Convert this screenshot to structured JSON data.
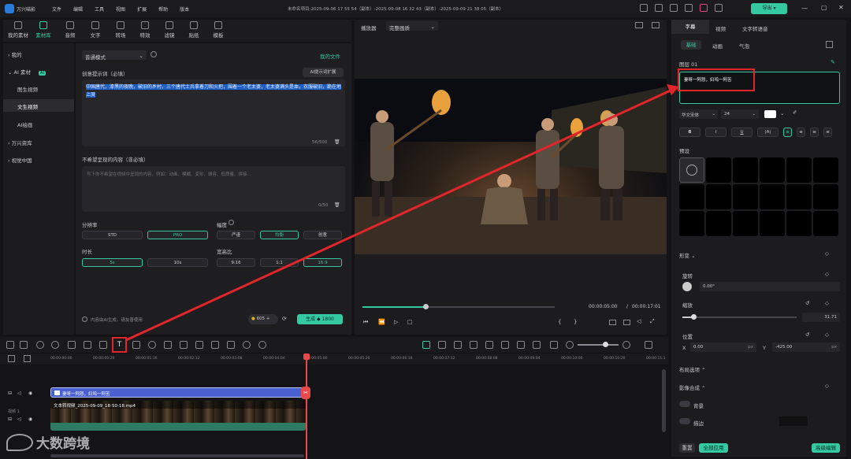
{
  "app": {
    "title": "万兴喵影",
    "menu": [
      "文件",
      "编辑",
      "工具",
      "视图",
      "扩展",
      "帮助",
      "版本"
    ],
    "doc_title": "未命名项目-2025-09-06 17 55 54（副本）-2025-09-08 16 32 43（副本）-2025-09-09 21 38 05（副本）",
    "export_label": "导出",
    "accent": "#34c9a0"
  },
  "toolbar": {
    "tabs": [
      "我的素材",
      "素材库",
      "音频",
      "文字",
      "转场",
      "特效",
      "滤镜",
      "贴纸",
      "模板"
    ],
    "active": "素材库"
  },
  "sidebar": {
    "items": [
      "我的",
      "AI 素材",
      "图生视频",
      "文生视频",
      "AI绘画",
      "万兴资库",
      "视觉中国"
    ],
    "ai_badge": "AI"
  },
  "gen": {
    "mode": "普通模式",
    "my_files": "我的文件",
    "prompt_label": "创意提示词（必填）",
    "ai_expand": "AI提示词扩展",
    "prompt_text": "中国唐代，漆黑的夜晚，破旧的乡村，三个唐代士兵拿着刀和火把，围着一个老太婆，老太婆满头是血，衣服破旧，跪在地上哭",
    "prompt_count": "56/500",
    "neg_label": "不希望呈现的内容（非必填）",
    "neg_placeholder": "写下你不希望在视频中呈现的内容，例如：动画、模糊、变形、毁容、低质量、拼接...",
    "neg_count": "0/50",
    "res_label": "分辨率",
    "res": [
      "STD",
      "PRO"
    ],
    "motion_label": "幅度",
    "motion": [
      "严谨",
      "均衡",
      "创意"
    ],
    "dur_label": "时长",
    "dur": [
      "5s",
      "10s"
    ],
    "ratio_label": "宽高比",
    "ratio": [
      "9:16",
      "1:1",
      "16:9"
    ],
    "notice": "内容由AI生成，请友善使用",
    "credits": "605",
    "generate": "生成",
    "gen_cost": "1800"
  },
  "player": {
    "label": "播放器",
    "quality": "完整画质",
    "time_cur": "00:00:05:00",
    "time_total": "00:00:17:01"
  },
  "right": {
    "tabs": [
      "字幕",
      "视频",
      "文字转语音"
    ],
    "subtabs": [
      "基础",
      "动画",
      "气泡"
    ],
    "layer": "图层 01",
    "text": "妻呀一阿怒，妇呜一阿苦",
    "font": "华文宋体",
    "size": "24",
    "preset_label": "预设",
    "transform": "形变",
    "rotate_label": "旋转",
    "rotate_val": "0.00°",
    "scale_label": "缩放",
    "scale_val": "31.71",
    "pos_label": "位置",
    "x_label": "X",
    "x_val": "0.00",
    "y_label": "Y",
    "y_val": "-425.00",
    "unit": "px",
    "layout": "布局选项",
    "compose": "影像合成",
    "bg": "背景",
    "border": "描边",
    "reset": "重置",
    "apply_all": "全部应用",
    "advanced": "高级编辑"
  },
  "timeline": {
    "ticks": [
      "00:00:00:00",
      "00:00:00:20",
      "00:00:01:16",
      "00:00:02:12",
      "00:00:03:08",
      "00:00:04:04",
      "00:00:05:00",
      "00:00:05:20",
      "00:00:06:16",
      "00:00:07:12",
      "00:00:08:08",
      "00:00:09:04",
      "00:00:10:00",
      "00:00:10:20",
      "00:00:11:1"
    ],
    "subtitle_clip": "妻呀一阿怒，妇呜一阿苦",
    "video_clip": "文本转视频_2025-09-09_18-50-18.mp4",
    "track_label": "视频 1"
  },
  "watermark": {
    "text": "大数跨境"
  }
}
